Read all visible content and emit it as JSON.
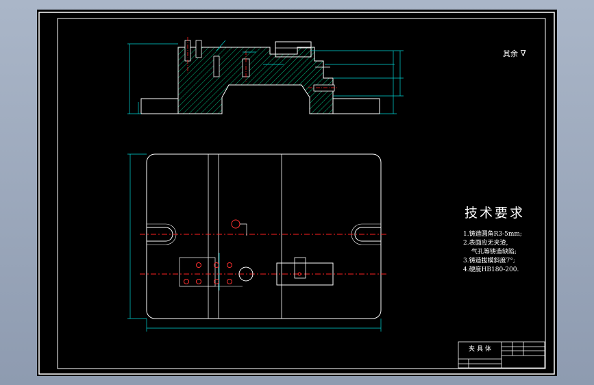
{
  "drawing": {
    "surface_finish_note": "其余",
    "tech_requirements": {
      "title": "技术要求",
      "items": [
        "1.铸造圆角R3-5mm;",
        "2.表面应无夹渣,",
        "气孔等铸造缺陷;",
        "3.铸造拔模斜度7°;",
        "4.硬度HB180-200."
      ]
    },
    "title_block": {
      "name": "夹具体"
    }
  },
  "colors": {
    "background": "#000000",
    "outline": "#ffffff",
    "dimension": "#00d8d8",
    "centerline": "#ff2020",
    "hole": "#ff3030",
    "hatch": "#00c080",
    "frame": "#ffffff"
  }
}
